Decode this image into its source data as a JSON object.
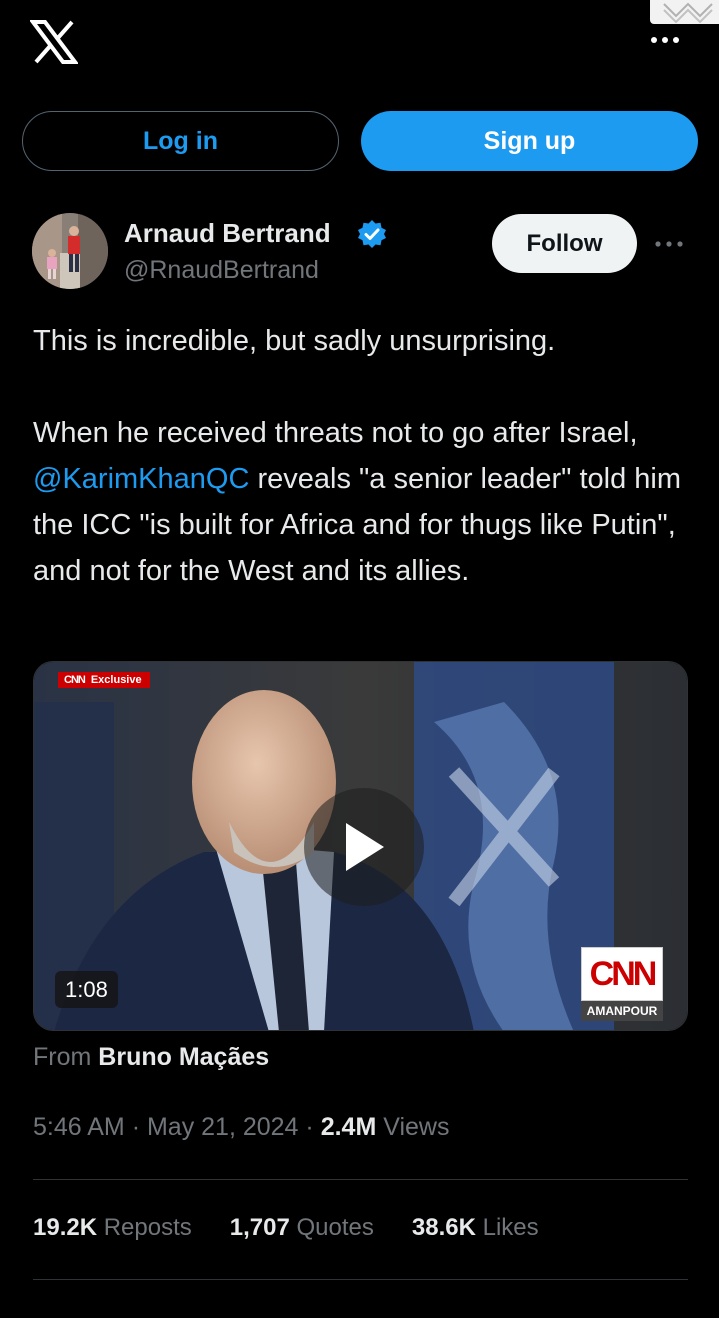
{
  "header": {
    "logo_icon": "x-logo-icon",
    "more_icon": "more-dots-icon",
    "login_label": "Log in",
    "signup_label": "Sign up"
  },
  "author": {
    "name": "Arnaud Bertrand",
    "handle": "@RnaudBertrand",
    "verified_icon": "verified-badge-icon",
    "follow_label": "Follow"
  },
  "tweet": {
    "line1": "This is incredible, but sadly unsurprising.",
    "para2_before": "When he received threats not to go after Israel, ",
    "mention": "@KarimKhanQC",
    "para2_after": " reveals \"a senior leader\" told him the ICC \"is built for Africa and for thugs like Putin\", and not for the West and its allies."
  },
  "media": {
    "tag_logo": "CNN",
    "tag_label": "Exclusive",
    "duration": "1:08",
    "channel_logo": "CNN",
    "show_label": "AMANPOUR",
    "play_icon": "play-icon"
  },
  "source": {
    "prefix": "From",
    "name": "Bruno Maçães"
  },
  "meta": {
    "time": "5:46 AM",
    "separator": "·",
    "date": "May 21, 2024",
    "views_count": "2.4M",
    "views_label": "Views"
  },
  "stats": {
    "reposts_count": "19.2K",
    "reposts_label": "Reposts",
    "quotes_count": "1,707",
    "quotes_label": "Quotes",
    "likes_count": "38.6K",
    "likes_label": "Likes"
  },
  "colors": {
    "background": "#000000",
    "accent": "#1d9bf0",
    "text_primary": "#e7e9ea",
    "text_secondary": "#71767b",
    "cnn_red": "#cc0000"
  }
}
